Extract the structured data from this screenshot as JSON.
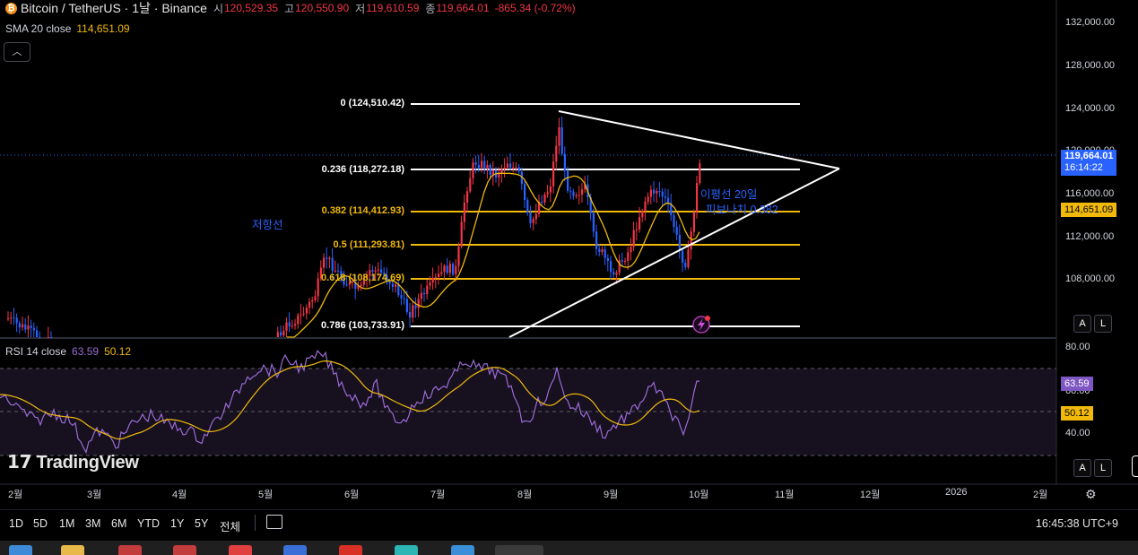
{
  "header": {
    "symbol": "Bitcoin / TetherUS · 1날 · Binance",
    "open_label": "시",
    "open": "120,529.35",
    "high_label": "고",
    "high": "120,550.90",
    "low_label": "저",
    "low": "119,610.59",
    "close_label": "종",
    "close": "119,664.01",
    "change": "-865.34 (-0.72%)"
  },
  "sma": {
    "label": "SMA 20 close",
    "value": "114,651.09"
  },
  "collapse_icon": "chevron-up-icon",
  "rsi": {
    "label": "RSI 14 close",
    "value": "63.59",
    "ma": "50.12"
  },
  "price_axis": [
    "132,000.00",
    "128,000.00",
    "124,000.00",
    "120,000.00",
    "116,000.00",
    "112,000.00",
    "108,000.00"
  ],
  "rsi_axis": [
    "80.00",
    "60.00",
    "40.00"
  ],
  "tags": {
    "price": "119,664.01",
    "countdown": "16:14:22",
    "sma": "114,651.09",
    "rsi": "63.59",
    "rsi_ma": "50.12"
  },
  "fib": {
    "l0": "0 (124,510.42)",
    "l236": "0.236 (118,272.18)",
    "l382": "0.382 (114,412.93)",
    "l5": "0.5 (111,293.81)",
    "l618": "0.618 (108,174.69)",
    "l786": "0.786 (103,733.91)"
  },
  "annotations": {
    "resistance": "저항선",
    "ma20": "이평선 20일",
    "fib382": "피보나치 0.382"
  },
  "time_axis": [
    "2월",
    "3월",
    "4월",
    "5월",
    "6월",
    "7월",
    "8월",
    "9월",
    "10월",
    "11월",
    "12월",
    "2026",
    "2월"
  ],
  "scale_buttons": {
    "auto": "A",
    "log": "L"
  },
  "logo": "TradingView",
  "ranges": [
    "1D",
    "5D",
    "1M",
    "3M",
    "6M",
    "YTD",
    "1Y",
    "5Y",
    "전체"
  ],
  "clock": "16:45:38 UTC+9",
  "colors": {
    "up": "#f23645",
    "down": "#2962ff",
    "sma": "#f0b90b",
    "rsi": "#9c6bd6",
    "fib_yellow": "#f0b90b"
  }
}
